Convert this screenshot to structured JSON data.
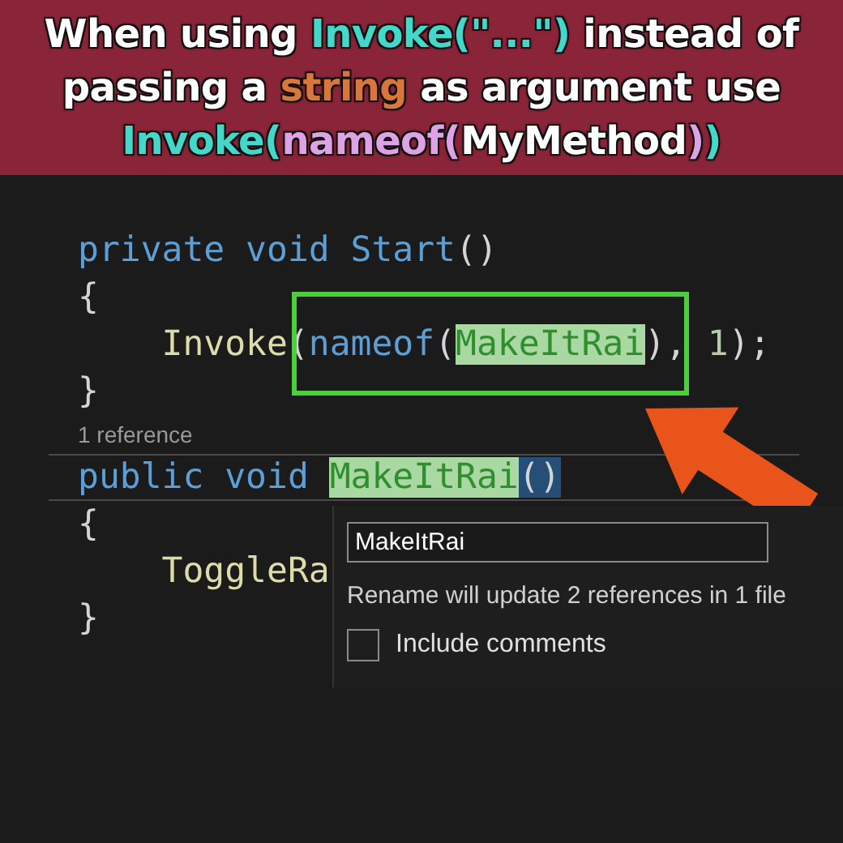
{
  "caption": {
    "lines": [
      [
        {
          "text": "When using ",
          "kind": "plain"
        },
        {
          "text": "Invoke(\"...\")",
          "kind": "cyan"
        },
        {
          "text": " instead of",
          "kind": "plain"
        }
      ],
      [
        {
          "text": "passing a ",
          "kind": "plain"
        },
        {
          "text": "string",
          "kind": "orange"
        },
        {
          "text": " as argument use",
          "kind": "plain"
        }
      ],
      [
        {
          "text": "Invoke(",
          "kind": "cyan"
        },
        {
          "text": "nameof(",
          "kind": "pink"
        },
        {
          "text": "MyMethod",
          "kind": "plain"
        },
        {
          "text": ")",
          "kind": "pink"
        },
        {
          "text": ")",
          "kind": "cyan"
        }
      ]
    ]
  },
  "editor": {
    "lines": [
      {
        "kind": "code",
        "tokens": [
          {
            "text": "private void Start",
            "kind": "keyword"
          },
          {
            "text": "()",
            "kind": "punct"
          }
        ]
      },
      {
        "kind": "code",
        "tokens": [
          {
            "text": "{",
            "kind": "punct"
          }
        ]
      },
      {
        "kind": "code",
        "tokens": [
          {
            "text": "    Invoke",
            "kind": "method"
          },
          {
            "text": "(",
            "kind": "punct"
          },
          {
            "text": "nameof",
            "kind": "keyword"
          },
          {
            "text": "(",
            "kind": "punct"
          },
          {
            "text": "MakeItRai",
            "kind": "renamed"
          },
          {
            "text": "), ",
            "kind": "punct"
          },
          {
            "text": "1",
            "kind": "number"
          },
          {
            "text": ");",
            "kind": "punct"
          }
        ]
      },
      {
        "kind": "code",
        "tokens": [
          {
            "text": "}",
            "kind": "punct"
          }
        ]
      },
      {
        "kind": "codelens",
        "tokens": [
          {
            "text": "1 reference",
            "kind": "plain"
          }
        ]
      },
      {
        "kind": "rename",
        "tokens": [
          {
            "text": "public void ",
            "kind": "keyword"
          },
          {
            "text": "MakeItRai",
            "kind": "renamed"
          },
          {
            "text": "()",
            "kind": "brace-match"
          }
        ]
      },
      {
        "kind": "code",
        "tokens": [
          {
            "text": "{",
            "kind": "punct"
          }
        ]
      },
      {
        "kind": "code",
        "tokens": [
          {
            "text": "    ToggleRa",
            "kind": "method"
          }
        ]
      },
      {
        "kind": "code",
        "tokens": [
          {
            "text": "}",
            "kind": "punct"
          }
        ]
      }
    ]
  },
  "rename_popup": {
    "value": "MakeItRai",
    "message": "Rename will update 2 references in 1 file",
    "options": [
      {
        "label": "Include comments",
        "checked": false
      }
    ]
  }
}
